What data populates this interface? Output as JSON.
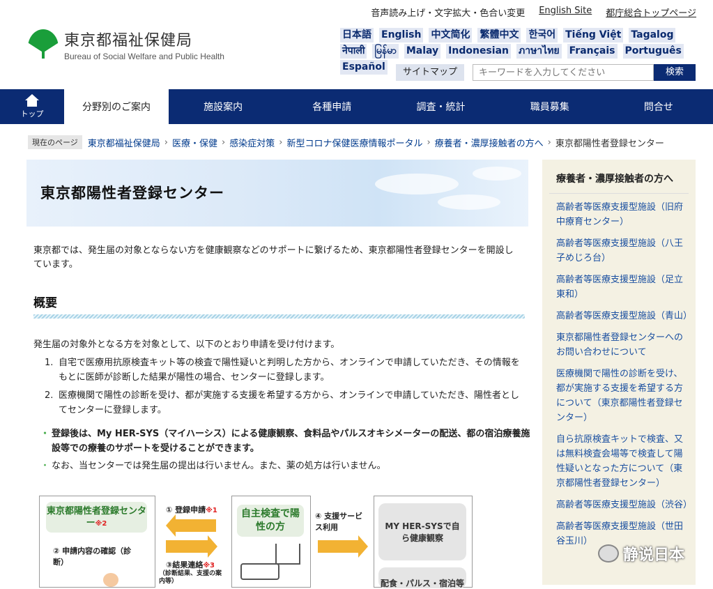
{
  "header": {
    "utility": [
      "音声読み上げ・文字拡大・色合い変更",
      "English Site",
      "都庁総合トップページ"
    ],
    "logo_ja": "東京都福祉保健局",
    "logo_en": "Bureau of Social Welfare and Public Health",
    "languages": [
      "日本語",
      "English",
      "中文简化",
      "繁體中文",
      "한국어",
      "Tiếng Việt",
      "Tagalog",
      "नेपाली",
      "မြန်မာ",
      "Malay",
      "Indonesian",
      "ภาษาไทย",
      "Français",
      "Português",
      "Español"
    ],
    "sitemap": "サイトマップ",
    "search_placeholder": "キーワードを入力してください",
    "search_button": "検索"
  },
  "nav": {
    "home": "トップ",
    "items": [
      "分野別のご案内",
      "施設案内",
      "各種申請",
      "調査・統計",
      "職員募集",
      "問合せ"
    ]
  },
  "breadcrumb": {
    "here": "現在のページ",
    "items": [
      "東京都福祉保健局",
      "医療・保健",
      "感染症対策",
      "新型コロナ保健医療情報ポータル",
      "療養者・濃厚接触者の方へ"
    ],
    "current": "東京都陽性者登録センター"
  },
  "main": {
    "title": "東京都陽性者登録センター",
    "intro": "東京都では、発生届の対象とならない方を健康観察などのサポートに繋げるため、東京都陽性者登録センターを開設しています。",
    "section_title": "概要",
    "lead": "発生届の対象外となる方を対象として、以下のとおり申請を受け付けます。",
    "steps": [
      {
        "num": "1.",
        "text": "自宅で医療用抗原検査キット等の検査で陽性疑いと判明した方から、オンラインで申請していただき、その情報をもとに医師が診断した結果が陽性の場合、センターに登録します。"
      },
      {
        "num": "2.",
        "text": "医療機関で陽性の診断を受け、都が実施する支援を希望する方から、オンラインで申請していただき、陽性者としてセンターに登録します。"
      }
    ],
    "note_bold": "登録後は、My HER-SYS（マイハーシス）による健康観察、食料品やパルスオキシメーターの配送、都の宿泊療養施設等での療養のサポートを受けることができます。",
    "note": "なお、当センターでは発生届の提出は行いません。また、薬の処方は行いません。"
  },
  "diagram": {
    "center_title": "東京都陽性者登録センター",
    "center_mark": "※2",
    "confirm": "② 申請内容の確認（診断）",
    "step1": "① 登録申請",
    "step1_mark": "※1",
    "step3": "③結果連絡",
    "step3_mark": "※3",
    "step3_sub": "（診断結果、支援の案内等）",
    "self_title": "自主検査で陽性の方",
    "step4": "④ 支援サービス利用",
    "service1": "MY HER-SYSで自ら健康観察",
    "service2": "配食・パルス・宿泊等"
  },
  "sidebar": {
    "title": "療養者・濃厚接触者の方へ",
    "links": [
      "高齢者等医療支援型施設（旧府中療育センター）",
      "高齢者等医療支援型施設（八王子めじろ台）",
      "高齢者等医療支援型施設（足立東和）",
      "高齢者等医療支援型施設（青山）",
      "東京都陽性者登録センターへのお問い合わせについて",
      "医療機関で陽性の診断を受け、都が実施する支援を希望する方について（東京都陽性者登録センター）",
      "自ら抗原検査キットで検査、又は無料検査会場等で検査して陽性疑いとなった方について（東京都陽性者登録センター）",
      "高齢者等医療支援型施設（渋谷）",
      "高齢者等医療支援型施設（世田谷玉川）"
    ]
  },
  "watermark": "静说日本"
}
